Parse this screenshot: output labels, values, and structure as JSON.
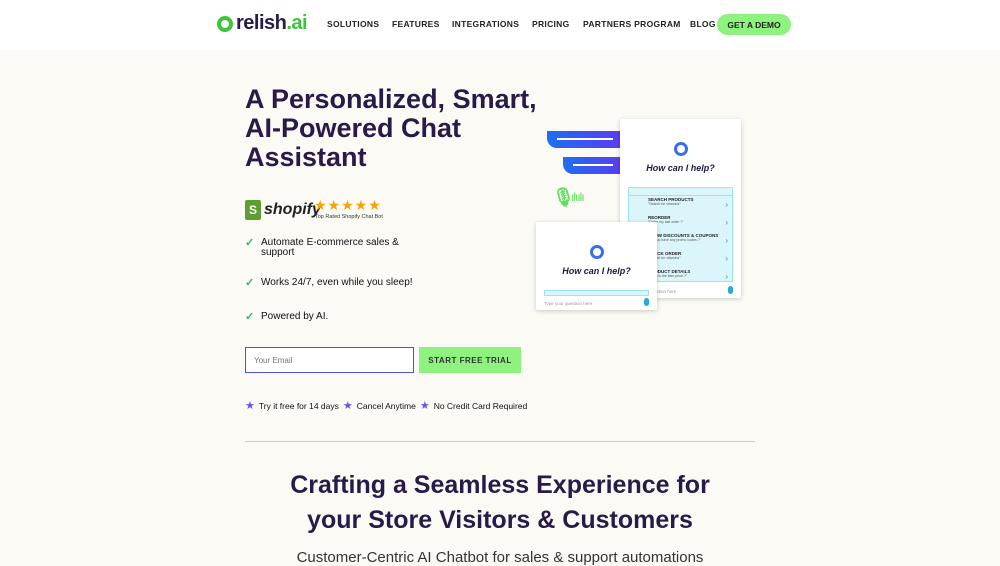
{
  "header": {
    "logo": {
      "main": "relish",
      "accent": ".ai"
    },
    "nav": [
      "SOLUTIONS",
      "FEATURES",
      "INTEGRATIONS",
      "PRICING",
      "PARTNERS PROGRAM",
      "BLOG"
    ],
    "cta": "GET A DEMO"
  },
  "hero": {
    "title": "A Personalized, Smart, AI-Powered Chat Assistant",
    "shopify": {
      "brand": "shopify",
      "stars": "★★★★★",
      "rating": 5,
      "caption": "Top Rated Shopify Chat Bot"
    },
    "features": [
      "Automate E-commerce sales & support",
      "Works 24/7, even while you sleep!",
      "Powered by AI."
    ],
    "email_placeholder": "Your Email",
    "trial_button": "START FREE TRIAL",
    "perks": [
      "Try it free for 14 days",
      "Cancel Anytime",
      "No Credit Card Required"
    ]
  },
  "chat": {
    "prompt": "How can I help?",
    "input_placeholder": "Type your question here",
    "options": [
      {
        "title": "SEARCH PRODUCTS",
        "example": "\"Search for vitamins\""
      },
      {
        "title": "REORDER",
        "example": "\"Order my last order ?\""
      },
      {
        "title": "SHOW DISCOUNTS & COUPONS",
        "example": "\"Do you have any promo codes ?\""
      },
      {
        "title": "TRACK ORDER",
        "example": "\"Search for vitamins\""
      },
      {
        "title": "PRODUCT DETAILS",
        "example": "\"What is the item price ?\""
      }
    ]
  },
  "section": {
    "title_line1": "Crafting a Seamless Experience for",
    "title_line2": "your Store Visitors & Customers",
    "subtitle": "Customer-Centric AI Chatbot for sales & support automations"
  },
  "colors": {
    "brand_green": "#3cc43c",
    "cta_green": "#8ef27e",
    "headline": "#2a1a4a",
    "star": "#6b4ef0"
  }
}
